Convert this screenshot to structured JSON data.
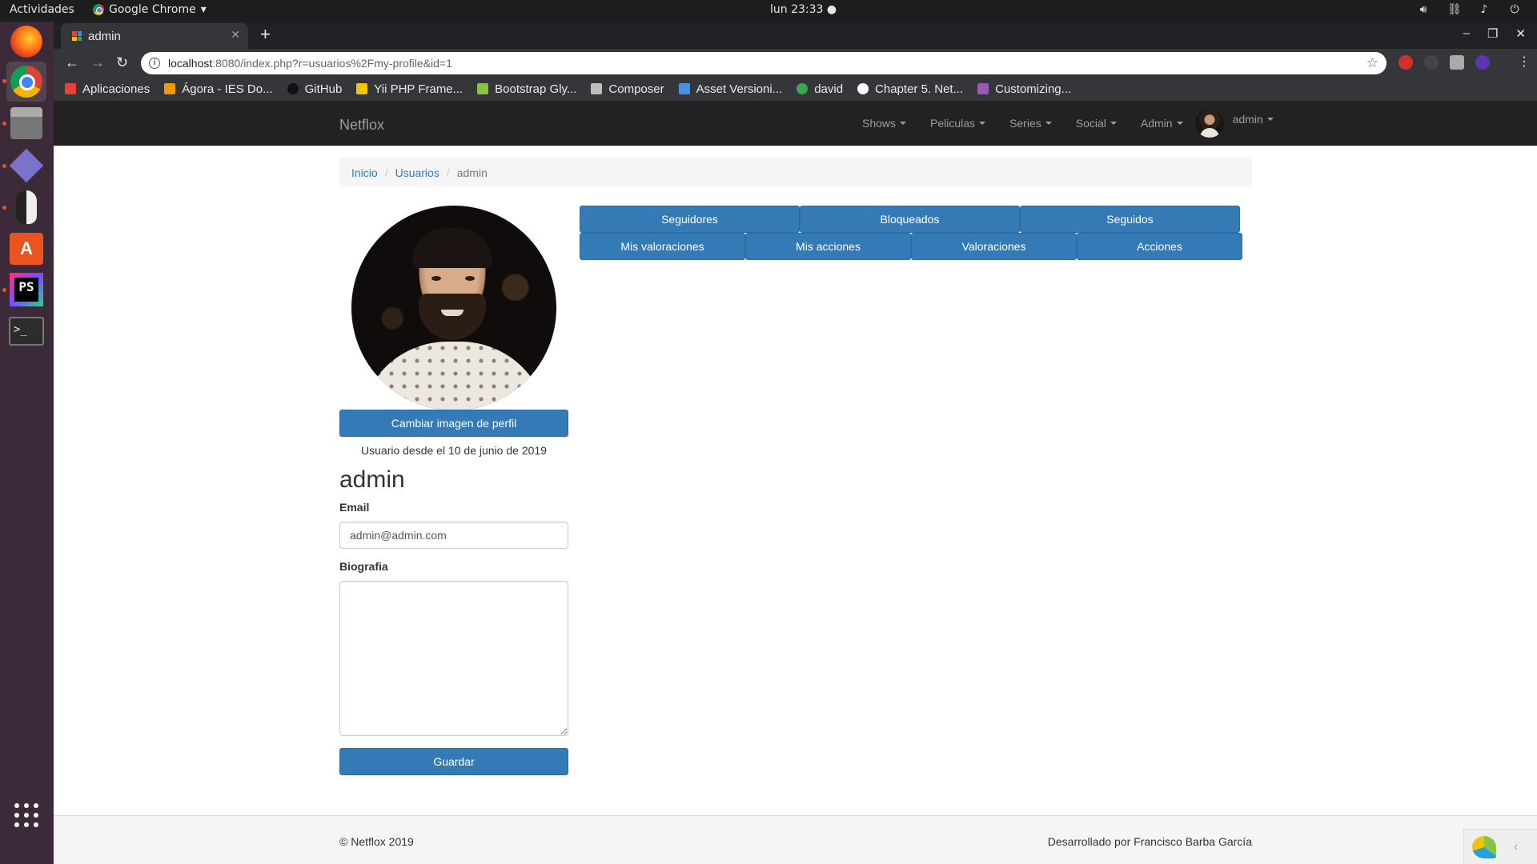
{
  "os": {
    "activities": "Actividades",
    "app_name": "Google Chrome",
    "clock": "lun 23:33 ●",
    "dock_items": [
      "firefox-icon",
      "chrome-icon",
      "files-icon",
      "diamond-app-icon",
      "penguin-app-icon",
      "software-store-icon",
      "phpstorm-icon",
      "terminal-icon",
      "app-grid-icon"
    ]
  },
  "browser": {
    "tab_title": "admin",
    "url_host": "localhost",
    "url_rest": ":8080/index.php?r=usuarios%2Fmy-profile&id=1",
    "bookmarks": [
      {
        "label": "Aplicaciones",
        "color": "#e94235"
      },
      {
        "label": "Ágora - IES Do...",
        "color": "#f29900"
      },
      {
        "label": "GitHub",
        "color": "#ffffff"
      },
      {
        "label": "Yii PHP Frame...",
        "color": "#f5c300"
      },
      {
        "label": "Bootstrap Gly...",
        "color": "#88c441"
      },
      {
        "label": "Composer",
        "color": "#bdbdbd"
      },
      {
        "label": "Asset Versioni...",
        "color": "#4a90e2"
      },
      {
        "label": "david",
        "color": "#34a853"
      },
      {
        "label": "Chapter 5. Net...",
        "color": "#ffffff"
      },
      {
        "label": "Customizing...",
        "color": "#9b59b6"
      }
    ]
  },
  "site": {
    "brand": "Netflox",
    "nav": [
      {
        "label": "Shows"
      },
      {
        "label": "Peliculas"
      },
      {
        "label": "Series"
      },
      {
        "label": "Social"
      },
      {
        "label": "Admin"
      }
    ],
    "user_menu": "admin"
  },
  "breadcrumb": {
    "home": "Inicio",
    "users": "Usuarios",
    "current": "admin"
  },
  "profile": {
    "change_image_label": "Cambiar imagen de perfil",
    "member_since": "Usuario desde el 10 de junio de 2019",
    "username": "admin",
    "email_label": "Email",
    "email_value": "admin@admin.com",
    "bio_label": "Biografia",
    "bio_value": "",
    "save_label": "Guardar"
  },
  "tabs_row1": [
    "Seguidores",
    "Bloqueados",
    "Seguidos"
  ],
  "tabs_row2": [
    "Mis valoraciones",
    "Mis acciones",
    "Valoraciones",
    "Acciones"
  ],
  "footer": {
    "copyright": "© Netflox 2019",
    "credits": "Desarrollado por Francisco Barba García"
  },
  "colors": {
    "primary": "#337ab7",
    "navbar": "#222222",
    "dock": "#3c2a38"
  }
}
